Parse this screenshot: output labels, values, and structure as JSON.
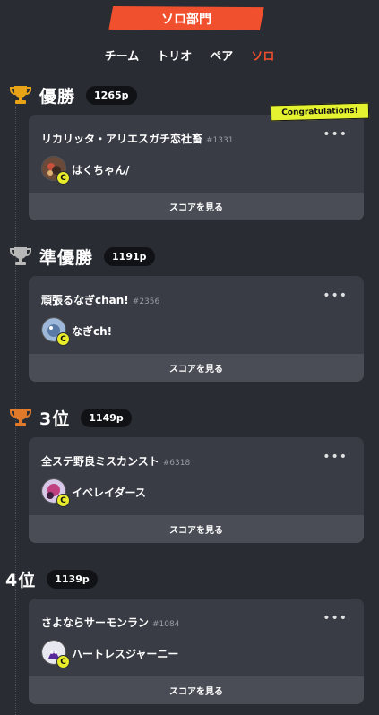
{
  "header": {
    "banner_label": "ソロ部門",
    "tabs": [
      {
        "label": "チーム",
        "active": false
      },
      {
        "label": "トリオ",
        "active": false
      },
      {
        "label": "ペア",
        "active": false
      },
      {
        "label": "ソロ",
        "active": true
      }
    ]
  },
  "accent_color": "#f0502e",
  "congrats_label": "Congratulations!",
  "ranks": [
    {
      "label": "優勝",
      "points": "1265p",
      "trophy": "gold-trophy-icon",
      "trophy_color": "#e8a317",
      "team_name": "リカリッタ・アリエスガチ恋社畜",
      "team_id": "#1331",
      "member_name": "はくちゃん/",
      "score_button": "スコアを見る"
    },
    {
      "label": "準優勝",
      "points": "1191p",
      "trophy": "silver-trophy-icon",
      "trophy_color": "#b8b8b8",
      "team_name": "頑張るなぎchan!",
      "team_id": "#2356",
      "member_name": "なぎch!",
      "score_button": "スコアを見る"
    },
    {
      "label": "3位",
      "points": "1149p",
      "trophy": "bronze-trophy-icon",
      "trophy_color": "#e07a2a",
      "team_name": "全ステ野良ミスカンスト",
      "team_id": "#6318",
      "member_name": "イベレイダース",
      "score_button": "スコアを見る"
    },
    {
      "label": "4位",
      "points": "1139p",
      "trophy": "",
      "trophy_color": "",
      "team_name": "さよならサーモンラン",
      "team_id": "#1084",
      "member_name": "ハートレスジャーニー",
      "score_button": "スコアを見る"
    }
  ],
  "badge_letter": "C",
  "more_glyph": "•••"
}
